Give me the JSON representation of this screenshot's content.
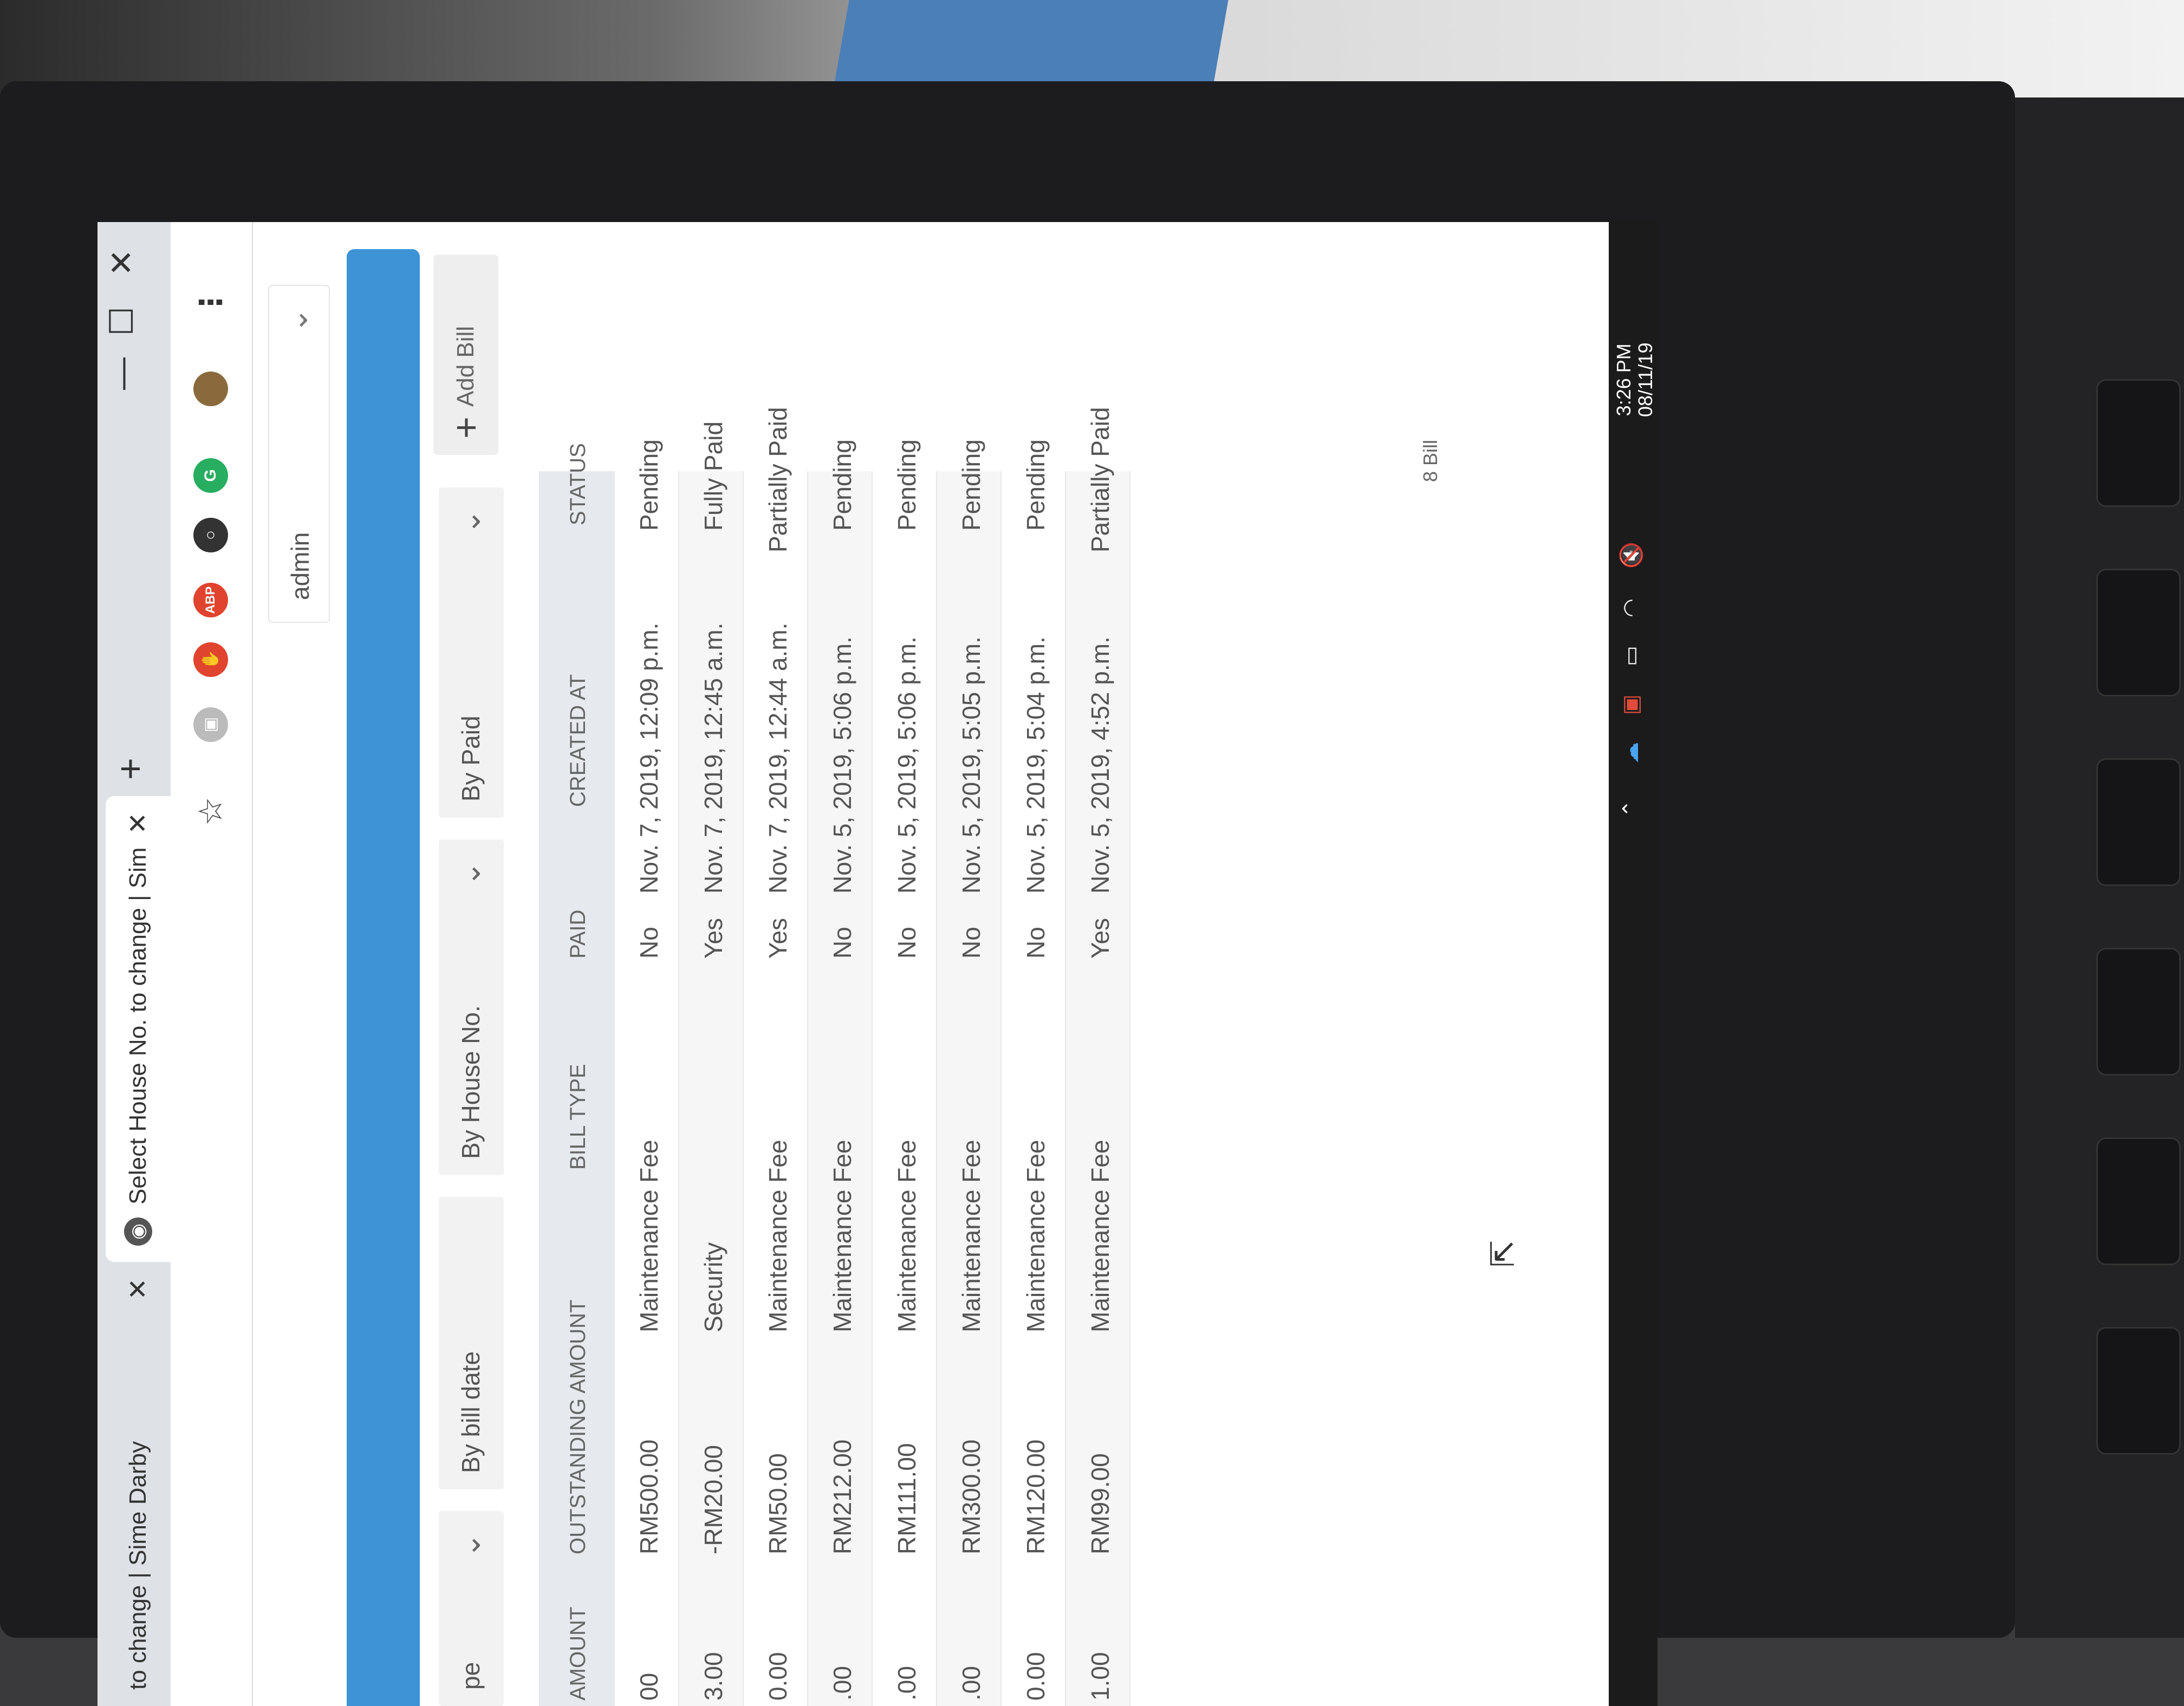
{
  "browser": {
    "tabs": [
      {
        "title": "to change | Sime Darby",
        "active": false
      },
      {
        "title": "Select House No. to change | Sim",
        "active": true
      }
    ],
    "new_tab": "+",
    "window_controls": [
      "—",
      "☐",
      "✕"
    ],
    "toolbar_icons": [
      "star-icon",
      "extension-icon",
      "stop-icon",
      "abp-icon",
      "circle-icon",
      "grammarly-icon",
      "profile-avatar",
      "menu-icon"
    ],
    "abp_label": "ABP",
    "grammarly_label": "G",
    "menu_label": "⋮"
  },
  "header": {
    "user_label": "admin",
    "accent_color": "#3d93d6"
  },
  "filters": [
    {
      "label": "pe"
    },
    {
      "label": "By bill date"
    },
    {
      "label": "By House No."
    },
    {
      "label": "By Paid"
    }
  ],
  "add_bill_label": "Add Bill",
  "table": {
    "columns": [
      "AMOUNT",
      "OUTSTANDING AMOUNT",
      "BILL TYPE",
      "PAID",
      "CREATED AT",
      "STATUS"
    ],
    "rows": [
      {
        "amount": "00",
        "outstanding": "RM500.00",
        "bill_type": "Maintenance Fee",
        "paid": "No",
        "created_at": "Nov. 7, 2019, 12:09 p.m.",
        "status": "Pending"
      },
      {
        "amount": "3.00",
        "outstanding": "-RM20.00",
        "bill_type": "Security",
        "paid": "Yes",
        "created_at": "Nov. 7, 2019, 12:45 a.m.",
        "status": "Fully Paid"
      },
      {
        "amount": "0.00",
        "outstanding": "RM50.00",
        "bill_type": "Maintenance Fee",
        "paid": "Yes",
        "created_at": "Nov. 7, 2019, 12:44 a.m.",
        "status": "Partially Paid"
      },
      {
        "amount": ".00",
        "outstanding": "RM212.00",
        "bill_type": "Maintenance Fee",
        "paid": "No",
        "created_at": "Nov. 5, 2019, 5:06 p.m.",
        "status": "Pending"
      },
      {
        "amount": ".00",
        "outstanding": "RM111.00",
        "bill_type": "Maintenance Fee",
        "paid": "No",
        "created_at": "Nov. 5, 2019, 5:06 p.m.",
        "status": "Pending"
      },
      {
        "amount": ".00",
        "outstanding": "RM300.00",
        "bill_type": "Maintenance Fee",
        "paid": "No",
        "created_at": "Nov. 5, 2019, 5:05 p.m.",
        "status": "Pending"
      },
      {
        "amount": "0.00",
        "outstanding": "RM120.00",
        "bill_type": "Maintenance Fee",
        "paid": "No",
        "created_at": "Nov. 5, 2019, 5:04 p.m.",
        "status": "Pending"
      },
      {
        "amount": "1.00",
        "outstanding": "RM99.00",
        "bill_type": "Maintenance Fee",
        "paid": "Yes",
        "created_at": "Nov. 5, 2019, 4:52 p.m.",
        "status": "Partially Paid"
      }
    ]
  },
  "result_count": "8 Bill",
  "taskbar": {
    "time": "3:26 PM",
    "date": "08/11/19",
    "tray_icons": [
      "chevron-up-icon",
      "cloud-icon",
      "app-icon",
      "battery-icon",
      "wifi-icon",
      "volume-muted-icon"
    ]
  }
}
